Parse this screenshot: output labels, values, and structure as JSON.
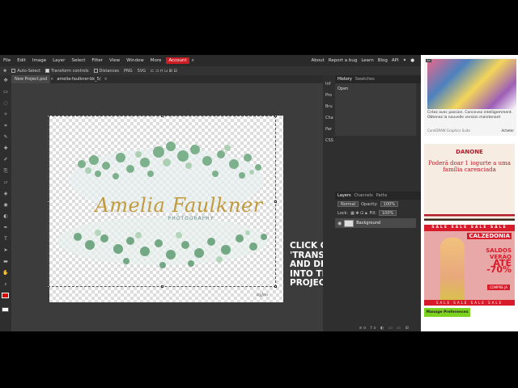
{
  "menubar": {
    "items": [
      "File",
      "Edit",
      "Image",
      "Layer",
      "Select",
      "Filter",
      "View",
      "Window",
      "More"
    ],
    "account": "Account",
    "right_items": [
      "About",
      "Report a bug",
      "Learn",
      "Blog",
      "API"
    ]
  },
  "options": {
    "auto_select": "Auto-Select",
    "transform_controls": "Transform controls",
    "distances": "Distances",
    "png": "PNG",
    "svg": "SVG"
  },
  "tabs": [
    "New Project.psd",
    "amelia-faulkner-bk_5/"
  ],
  "document": {
    "title": "Amelia Faulkner",
    "subtitle": "PHOTOGRAPHY",
    "signature": "byJno"
  },
  "overlay_text": [
    "CLICK ON",
    "'TRANSFORM CONTROLS'",
    "AND DRAG THE LOGO",
    "INTO THE PREVIOUS",
    "PROJECT"
  ],
  "right_strip": [
    "Inf",
    "Pro",
    "Bru",
    "Cha",
    "Par",
    "CSS"
  ],
  "history_panel": {
    "tabs": [
      "History",
      "Swatches"
    ],
    "rows": [
      "Open"
    ]
  },
  "layers_panel": {
    "tabs": [
      "Layers",
      "Channels",
      "Paths"
    ],
    "blend_mode": "Normal",
    "opacity_label": "Opacity:",
    "opacity": "100%",
    "lock_label": "Lock:",
    "fill_label": "Fill:",
    "fill": "100%",
    "layer_name": "Background",
    "footer": "eo fx ◐ ▭ ▭ ⊞"
  },
  "ads": {
    "ad1_label": "Ad",
    "ad1_text": "Créez avec passion. Concevez intelligemment. Obtenez la nouvelle version maintenant",
    "ad1_source": "CorelDRAW Graphics Suite",
    "ad1_button": "Acheter",
    "ad2_brand": "DANONE",
    "ad2_message": "Poderă doar 1 iogurte a uma família carenciada",
    "ad3_sale": "SALE SALE SALE SALE",
    "ad3_brand": "CALZEDONIA",
    "ad3_line1": "SALDOS",
    "ad3_line2": "VERÃO",
    "ad3_line3": "ATÉ -70%",
    "ad3_buy": "COMPRE JÁ",
    "manage_button": "Manage Preferences"
  },
  "colors": {
    "accent_red": "#cc1c23",
    "logo_gold": "#c29a3e",
    "manage_green": "#7ed321"
  }
}
